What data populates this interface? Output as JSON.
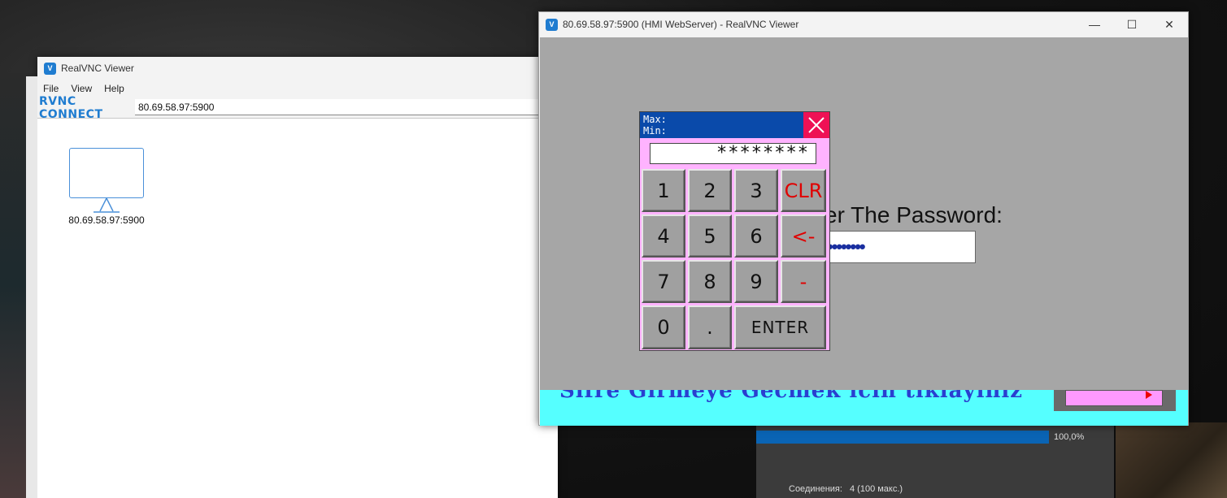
{
  "main_window": {
    "title": "RealVNC Viewer",
    "menu": [
      "File",
      "View",
      "Help"
    ],
    "brand": "RVNC CONNECT",
    "address_value": "80.69.58.97:5900",
    "entry_label": "80.69.58.97:5900"
  },
  "hmi_window": {
    "title": "80.69.58.97:5900 (HMI WebServer) - RealVNC Viewer",
    "controls": [
      "—",
      "☐",
      "✕"
    ],
    "prompt": "er The Password:",
    "password_mask": "••••••••",
    "strip_text": "Sifre Girmeye Gecmek icin tiklayiniz"
  },
  "keypad": {
    "max_label": "Max:",
    "min_label": "Min:",
    "display": "********",
    "keys": {
      "k1": "1",
      "k2": "2",
      "k3": "3",
      "clr": "CLR",
      "k4": "4",
      "k5": "5",
      "k6": "6",
      "back": "<-",
      "k7": "7",
      "k8": "8",
      "k9": "9",
      "minus": "-",
      "k0": "0",
      "dot": ".",
      "enter": "ENTER"
    }
  },
  "background_window": {
    "progress": 1.0,
    "progress_text": "100,0%",
    "connections_label": "Соединения:",
    "connections_value": "4 (100 макс.)"
  },
  "colors": {
    "hmi_bg": "#a6a6a6",
    "keypad_bg": "#ffb3ff",
    "keypad_header": "#0a4aaa",
    "close_red": "#ee1155",
    "accent_blue": "#1f7cd0"
  }
}
